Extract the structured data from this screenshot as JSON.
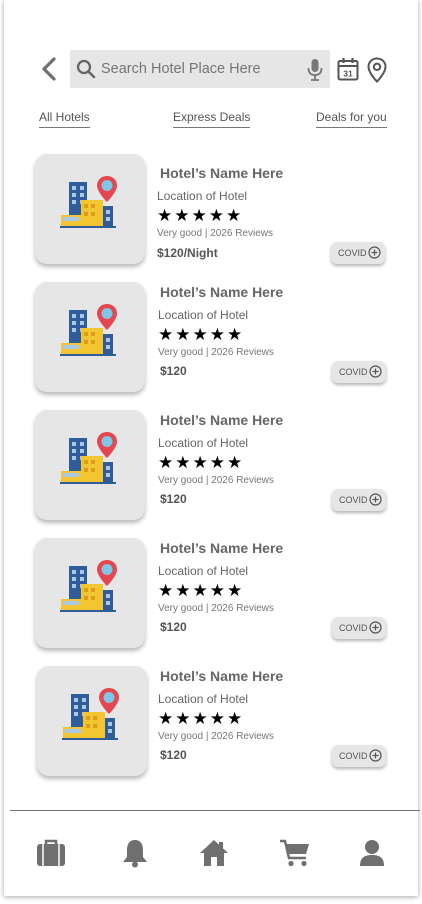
{
  "header": {
    "search_placeholder": "Search Hotel Place Here",
    "back_icon": "chevron-left-icon",
    "search_icon": "search-icon",
    "mic_icon": "microphone-icon",
    "calendar_icon": "calendar-icon",
    "calendar_day": "31",
    "location_icon": "location-pin-icon"
  },
  "tabs": [
    "All Hotels",
    "Express Deals",
    "Deals for you"
  ],
  "hotels": [
    {
      "name": "Hotel’s  Name Here",
      "location": "Location of Hotel",
      "stars": "★★★★★",
      "reviews": "Very good | 2026 Reviews",
      "price": "$120/Night",
      "badge": "COVID"
    },
    {
      "name": "Hotel’s  Name Here",
      "location": "Location of Hotel",
      "stars": "★★★★★",
      "reviews": "Very good | 2026 Reviews",
      "price": "$120",
      "badge": "COVID"
    },
    {
      "name": "Hotel’s  Name Here",
      "location": "Location of Hotel",
      "stars": "★★★★★",
      "reviews": "Very good | 2026 Reviews",
      "price": "$120",
      "badge": "COVID"
    },
    {
      "name": "Hotel’s  Name Here",
      "location": "Location of Hotel",
      "stars": "★★★★★",
      "reviews": "Very good | 2026 Reviews",
      "price": "$120",
      "badge": "COVID"
    },
    {
      "name": "Hotel’s  Name Here",
      "location": "Location of Hotel",
      "stars": "★★★★★",
      "reviews": "Very good | 2026 Reviews",
      "price": "$120",
      "badge": "COVID"
    }
  ],
  "bottom_nav": [
    "briefcase-icon",
    "bell-icon",
    "home-icon",
    "cart-icon",
    "user-icon"
  ],
  "colors": {
    "pin": "#e4474f",
    "pin_dot": "#7fc6e6",
    "building_blue": "#2f5d9a",
    "building_yellow": "#f2c531",
    "icon_gray": "#6f6f6f"
  }
}
